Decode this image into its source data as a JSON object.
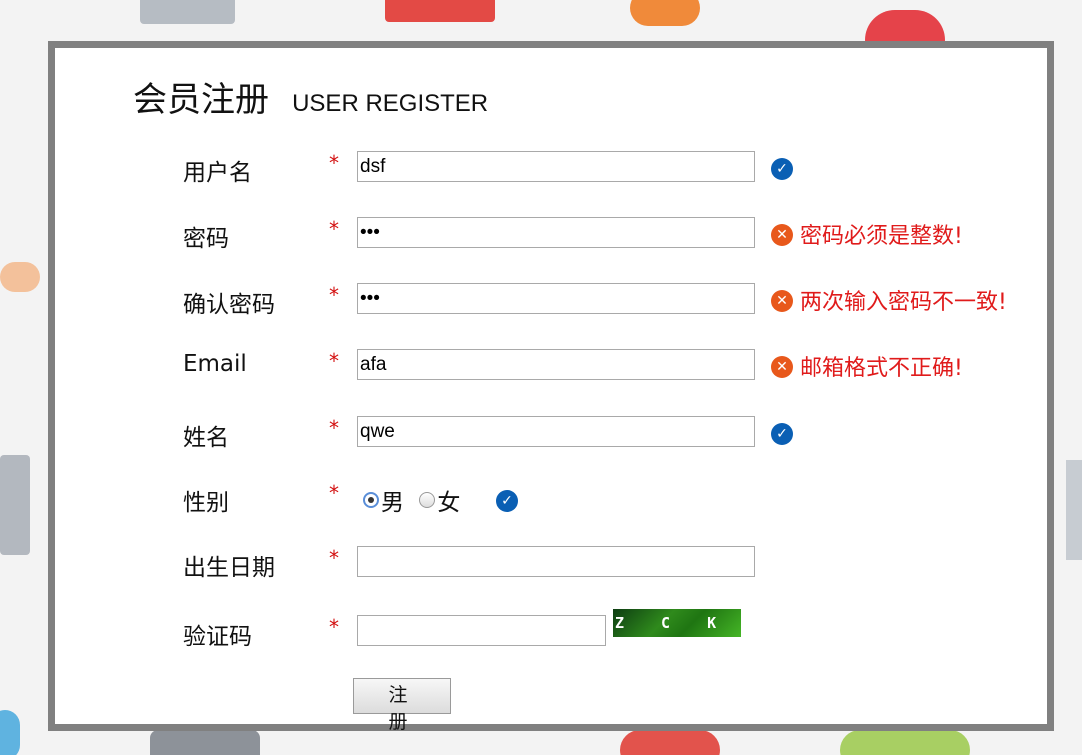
{
  "form": {
    "title_cn": "会员注册",
    "title_en": "USER REGISTER",
    "required_mark": "*",
    "username": {
      "label": "用户名",
      "value": "dsf",
      "status": "valid"
    },
    "password": {
      "label": "密码",
      "value": "•••",
      "status": "error",
      "message": "密码必须是整数!"
    },
    "confirm_password": {
      "label": "确认密码",
      "value": "•••",
      "status": "error",
      "message": "两次输入密码不一致!"
    },
    "email": {
      "label": "Email",
      "value": "afa",
      "status": "error",
      "message": "邮箱格式不正确!"
    },
    "name": {
      "label": "姓名",
      "value": "qwe",
      "status": "valid"
    },
    "gender": {
      "label": "性别",
      "options": [
        "男",
        "女"
      ],
      "selected": "男",
      "status": "valid"
    },
    "birthdate": {
      "label": "出生日期",
      "value": ""
    },
    "captcha": {
      "label": "验证码",
      "value": "",
      "image_text": "Z C K X"
    },
    "submit_label": "注 册"
  },
  "colors": {
    "border": "#808080",
    "required": "#d31010",
    "error_text": "#e01b1b",
    "error_icon": "#e8581b",
    "ok_icon": "#0a5fb4"
  },
  "icons": {
    "ok": "check-circle-icon",
    "error": "x-circle-icon"
  }
}
